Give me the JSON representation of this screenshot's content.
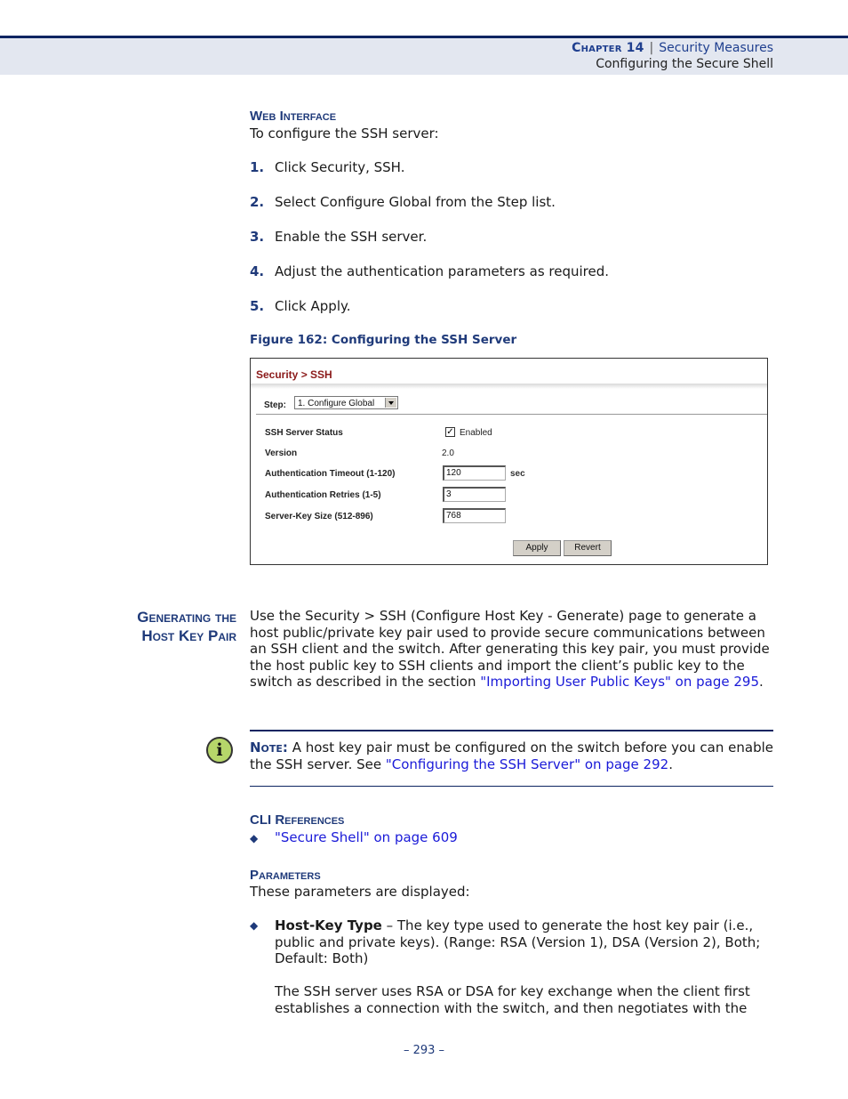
{
  "header": {
    "chapter": "Chapter 14",
    "separator": "|",
    "chapter_title": "Security Measures",
    "section": "Configuring the Secure Shell"
  },
  "web_interface": {
    "heading": "Web Interface",
    "intro": "To configure the SSH server:",
    "steps": [
      {
        "num": "1.",
        "text": "Click Security, SSH."
      },
      {
        "num": "2.",
        "text": "Select Configure Global from the Step list."
      },
      {
        "num": "3.",
        "text": "Enable the SSH server."
      },
      {
        "num": "4.",
        "text": "Adjust the authentication parameters as required."
      },
      {
        "num": "5.",
        "text": "Click Apply."
      }
    ]
  },
  "figure": {
    "caption": "Figure 162:  Configuring the SSH Server",
    "ui": {
      "breadcrumb": "Security > SSH",
      "step_label": "Step:",
      "step_value": "1. Configure Global",
      "rows": [
        {
          "label": "SSH Server Status",
          "type": "checkbox",
          "checked": true,
          "value": "Enabled"
        },
        {
          "label": "Version",
          "type": "text",
          "value": "2.0"
        },
        {
          "label": "Authentication Timeout (1-120)",
          "type": "input",
          "value": "120",
          "unit": "sec"
        },
        {
          "label": "Authentication Retries (1-5)",
          "type": "input",
          "value": "3"
        },
        {
          "label": "Server-Key Size (512-896)",
          "type": "input",
          "value": "768"
        }
      ],
      "checkmark": "✓",
      "apply_label": "Apply",
      "revert_label": "Revert"
    }
  },
  "host_key_section": {
    "side_heading_line1": "Generating the",
    "side_heading_line2": "Host Key Pair",
    "para_text": "Use the Security > SSH (Configure Host Key - Generate) page to generate a host public/private key pair used to provide secure communications between an SSH client and the switch. After generating this key pair, you must provide the host public key to SSH clients and import the client’s public key to the switch as described in the section ",
    "para_link": "\"Importing User Public Keys\" on page 295",
    "para_end": "."
  },
  "note": {
    "icon": "i",
    "label": "Note:",
    "text": " A host key pair must be configured on the switch before you can enable the SSH server. See ",
    "link": "\"Configuring the SSH Server\" on page 292",
    "end": "."
  },
  "cli_references": {
    "heading": "CLI References",
    "bullet": "◆",
    "items": [
      "\"Secure Shell\" on page 609"
    ]
  },
  "parameters": {
    "heading": "Parameters",
    "intro": "These parameters are displayed:",
    "items": [
      {
        "name": "Host-Key Type",
        "desc": " – The key type used to generate the host key pair (i.e., public and private keys). (Range: RSA (Version 1), DSA (Version 2), Both; Default: Both)",
        "extra": "The SSH server uses RSA or DSA for key exchange when the client first establishes a connection with the switch, and then negotiates with the"
      }
    ]
  },
  "footer": {
    "page_number": "–  293  –"
  }
}
